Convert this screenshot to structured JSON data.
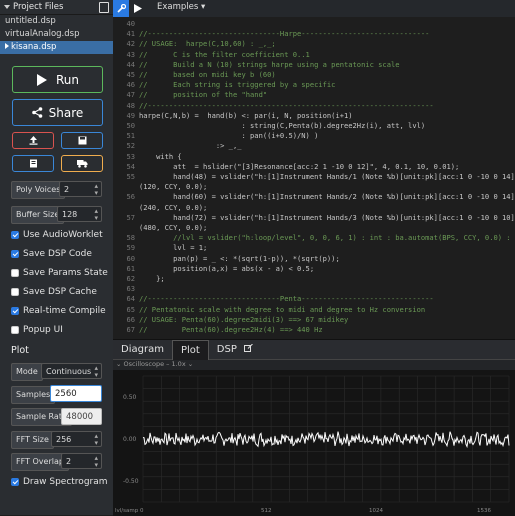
{
  "sidebar": {
    "header": "Project Files",
    "files": [
      "untitled.dsp",
      "virtualAnalog.dsp",
      "kisana.dsp"
    ],
    "run_label": "Run",
    "share_label": "Share",
    "poly_voices": {
      "label": "Poly Voices",
      "value": "2"
    },
    "buffer_size": {
      "label": "Buffer Size",
      "value": "128"
    },
    "checks": [
      {
        "label": "Use AudioWorklet",
        "checked": true
      },
      {
        "label": "Save DSP Code",
        "checked": true
      },
      {
        "label": "Save Params State",
        "checked": false
      },
      {
        "label": "Save DSP Cache",
        "checked": false
      },
      {
        "label": "Real-time Compile",
        "checked": true
      },
      {
        "label": "Popup UI",
        "checked": false
      }
    ],
    "plot_title": "Plot",
    "mode": {
      "label": "Mode",
      "value": "Continuous"
    },
    "samples": {
      "label": "Samples",
      "value": "2560"
    },
    "sample_rate": {
      "label": "Sample Rate",
      "value": "48000"
    },
    "fft_size": {
      "label": "FFT Size",
      "value": "256"
    },
    "fft_overlap": {
      "label": "FFT Overlap",
      "value": "2"
    },
    "draw_spectrogram": {
      "label": "Draw Spectrogram",
      "checked": true
    }
  },
  "topbar": {
    "examples_label": "Examples ▾"
  },
  "editor": {
    "lines": [
      {
        "n": "40",
        "t": "",
        "c": false
      },
      {
        "n": "41",
        "t": "//-------------------------------Harpe------------------------------",
        "c": true
      },
      {
        "n": "42",
        "t": "// USAGE:  harpe(C,10,60) : _,_;",
        "c": true
      },
      {
        "n": "43",
        "t": "//      C is the filter coefficient 0..1",
        "c": true
      },
      {
        "n": "44",
        "t": "//      Build a N (10) strings harpe using a pentatonic scale",
        "c": true
      },
      {
        "n": "45",
        "t": "//      based on midi key b (60)",
        "c": true
      },
      {
        "n": "46",
        "t": "//      Each string is triggered by a specific",
        "c": true
      },
      {
        "n": "47",
        "t": "//      position of the \"hand\"",
        "c": true
      },
      {
        "n": "48",
        "t": "//-------------------------------------------------------------------",
        "c": true
      },
      {
        "n": "49",
        "t": "harpe(C,N,b) =  hand(b) <: par(i, N, position(i+1)",
        "c": false
      },
      {
        "n": "50",
        "t": "                        : string(C,Penta(b).degree2Hz(i), att, lvl)",
        "c": false
      },
      {
        "n": "51",
        "t": "                        : pan((i+0.5)/N) )",
        "c": false
      },
      {
        "n": "52",
        "t": "                  :> _,_",
        "c": false
      },
      {
        "n": "53",
        "t": "    with {",
        "c": false
      },
      {
        "n": "54",
        "t": "        att  = hslider(\"[3]Resonance[acc:2 1 -10 0 12]\", 4, 0.1, 10, 0.01);",
        "c": false
      },
      {
        "n": "55",
        "t": "        hand(48) = vslider(\"h:[1]Instrument Hands/1 (Note %b)[unit:pk][acc:1 0 -10 0 14]\", 0, 0, N, 1) : int : ba.automat",
        "c": false
      },
      {
        "n": "",
        "t": "(120, CCY, 0.0);",
        "c": false
      },
      {
        "n": "56",
        "t": "        hand(60) = vslider(\"h:[1]Instrument Hands/2 (Note %b)[unit:pk][acc:1 0 -10 0 14]\", 2, 0, N, 1) : int : ba.automat",
        "c": false
      },
      {
        "n": "",
        "t": "(240, CCY, 0.0);",
        "c": false
      },
      {
        "n": "57",
        "t": "        hand(72) = vslider(\"h:[1]Instrument Hands/3 (Note %b)[unit:pk][acc:1 0 -10 0 10]\", 4, 0, N, 1) : int : ba.automat",
        "c": false
      },
      {
        "n": "",
        "t": "(480, CCY, 0.0);",
        "c": false
      },
      {
        "n": "58",
        "t": "        //lvl = vslider(\"h:loop/level\", 0, 0, 6, 1) : int : ba.automat(BPS, CCY, 0.0) : lvl",
        "c": true
      },
      {
        "n": "59",
        "t": "        lvl = 1;",
        "c": false
      },
      {
        "n": "60",
        "t": "        pan(p) = _ <: *(sqrt(1-p)), *(sqrt(p));",
        "c": false
      },
      {
        "n": "61",
        "t": "        position(a,x) = abs(x - a) < 0.5;",
        "c": false
      },
      {
        "n": "62",
        "t": "    };",
        "c": false
      },
      {
        "n": "63",
        "t": "",
        "c": false
      },
      {
        "n": "64",
        "t": "//-------------------------------Penta-------------------------------",
        "c": true
      },
      {
        "n": "65",
        "t": "// Pentatonic scale with degree to midi and degree to Hz conversion",
        "c": true
      },
      {
        "n": "66",
        "t": "// USAGE: Penta(60).degree2midi(3) ==> 67 midikey",
        "c": true
      },
      {
        "n": "67",
        "t": "//        Penta(60).degree2Hz(4) ==> 440 Hz",
        "c": true
      }
    ]
  },
  "panel": {
    "tabs": [
      "Diagram",
      "Plot",
      "DSP"
    ],
    "active_tab": "Plot",
    "oscilloscope_label": "Oscilloscope",
    "zoom": "1.0x",
    "y_ticks": [
      "0.50",
      "0.00",
      "-0.50"
    ],
    "x_ticks": [
      "0",
      "512",
      "1024",
      "1536"
    ],
    "axis_corner": "lvl/samp 0",
    "colors": {
      "grid": "#3a3a3a",
      "signal": "#ffffff",
      "accent": "#3a87d8"
    }
  }
}
